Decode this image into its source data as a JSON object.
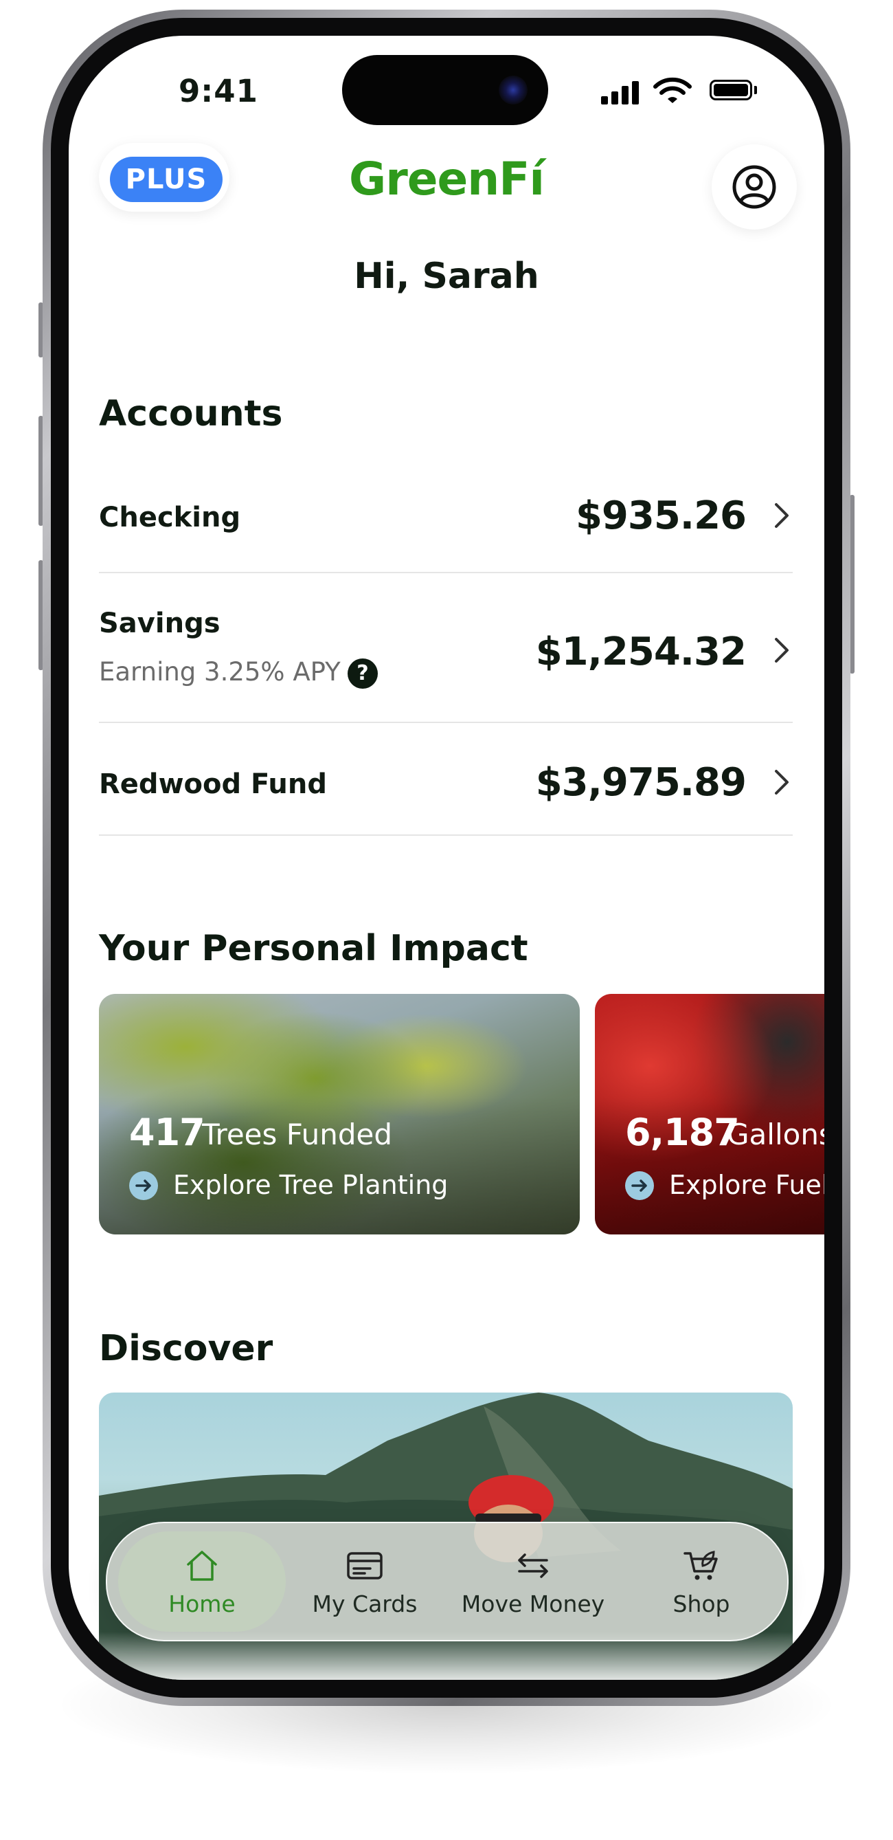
{
  "status_bar": {
    "time": "9:41"
  },
  "header": {
    "plus_badge": "PLUS",
    "logo": "GreenFí",
    "greeting": "Hi, Sarah",
    "profile_icon": "user-circle-icon"
  },
  "accounts": {
    "title": "Accounts",
    "items": [
      {
        "name": "Checking",
        "subtitle": "",
        "amount": "$935.26"
      },
      {
        "name": "Savings",
        "subtitle": "Earning 3.25% APY",
        "amount": "$1,254.32"
      },
      {
        "name": "Redwood Fund",
        "subtitle": "",
        "amount": "$3,975.89"
      }
    ],
    "help_symbol": "?"
  },
  "impact": {
    "title": "Your Personal Impact",
    "cards": [
      {
        "number": "417",
        "label": "Trees Funded",
        "link": "Explore Tree Planting"
      },
      {
        "number": "6,187",
        "label": "Gallons",
        "link": "Explore Fuel"
      }
    ]
  },
  "discover": {
    "title": "Discover"
  },
  "tabbar": {
    "items": [
      {
        "label": "Home",
        "icon": "home-icon",
        "active": true
      },
      {
        "label": "My Cards",
        "icon": "card-icon",
        "active": false
      },
      {
        "label": "Move Money",
        "icon": "transfer-icon",
        "active": false
      },
      {
        "label": "Shop",
        "icon": "shopping-cart-icon",
        "active": false
      }
    ]
  },
  "colors": {
    "brand_green": "#2f9a1c",
    "plus_blue": "#3b82f6",
    "text_dark": "#0d1a10"
  }
}
